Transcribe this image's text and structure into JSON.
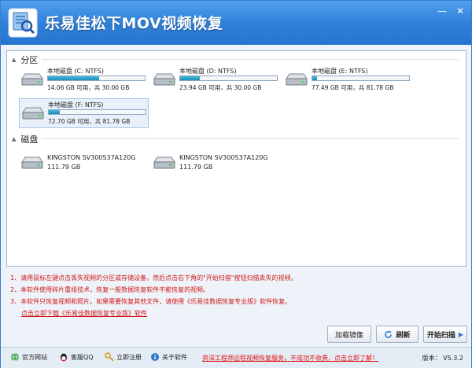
{
  "window": {
    "title": "乐易佳松下MOV视频恢复",
    "minimize_glyph": "—",
    "close_glyph": "✕"
  },
  "partitions": {
    "header": "分区",
    "items": [
      {
        "name": "本地磁盘 (C: NTFS)",
        "info": "14.06 GB 可用，共 30.00 GB",
        "used_fraction": 0.53,
        "selected": false
      },
      {
        "name": "本地磁盘 (D: NTFS)",
        "info": "23.94 GB 可用，共 30.00 GB",
        "used_fraction": 0.2,
        "selected": false
      },
      {
        "name": "本地磁盘 (E: NTFS)",
        "info": "77.49 GB 可用，共 81.78 GB",
        "used_fraction": 0.05,
        "selected": false
      },
      {
        "name": "本地磁盘 (F: NTFS)",
        "info": "72.70 GB 可用，共 81.78 GB",
        "used_fraction": 0.11,
        "selected": true
      }
    ]
  },
  "disks": {
    "header": "磁盘",
    "items": [
      {
        "name": "KINGSTON SV300S37A120G",
        "size": "111.79 GB"
      },
      {
        "name": "KINGSTON SV300S37A120G",
        "size": "111.79 GB"
      }
    ]
  },
  "notes": {
    "lines": [
      "1、请用鼠标左键点击丢失视频的分区或存储设备，然后点击右下角的\"开始扫描\"按钮扫描丢失的视频。",
      "2、本软件使用碎片重组技术，恢复一般数据恢复软件不能恢复的视频。",
      "3、本软件只恢复视频和照片。如果需要恢复其他文件，请使用《乐易佳数据恢复专业版》软件恢复。"
    ],
    "download_link": "点击立即下载《乐易佳数据恢复专业版》软件"
  },
  "buttons": {
    "load_image": "加载镜像",
    "refresh": "刷新",
    "start_scan": "开始扫描"
  },
  "statusbar": {
    "website": "官方网站",
    "qq": "客服QQ",
    "register": "立即注册",
    "about": "关于软件",
    "promo": "资深工程师远程视频恢复服务，不成功不收费，点击立即了解！",
    "version": "版本： V5.3.2"
  },
  "colors": {
    "titlebar": "#2e7fd9",
    "bar_fill": "#1c8fb8",
    "note_red": "#d01818"
  }
}
